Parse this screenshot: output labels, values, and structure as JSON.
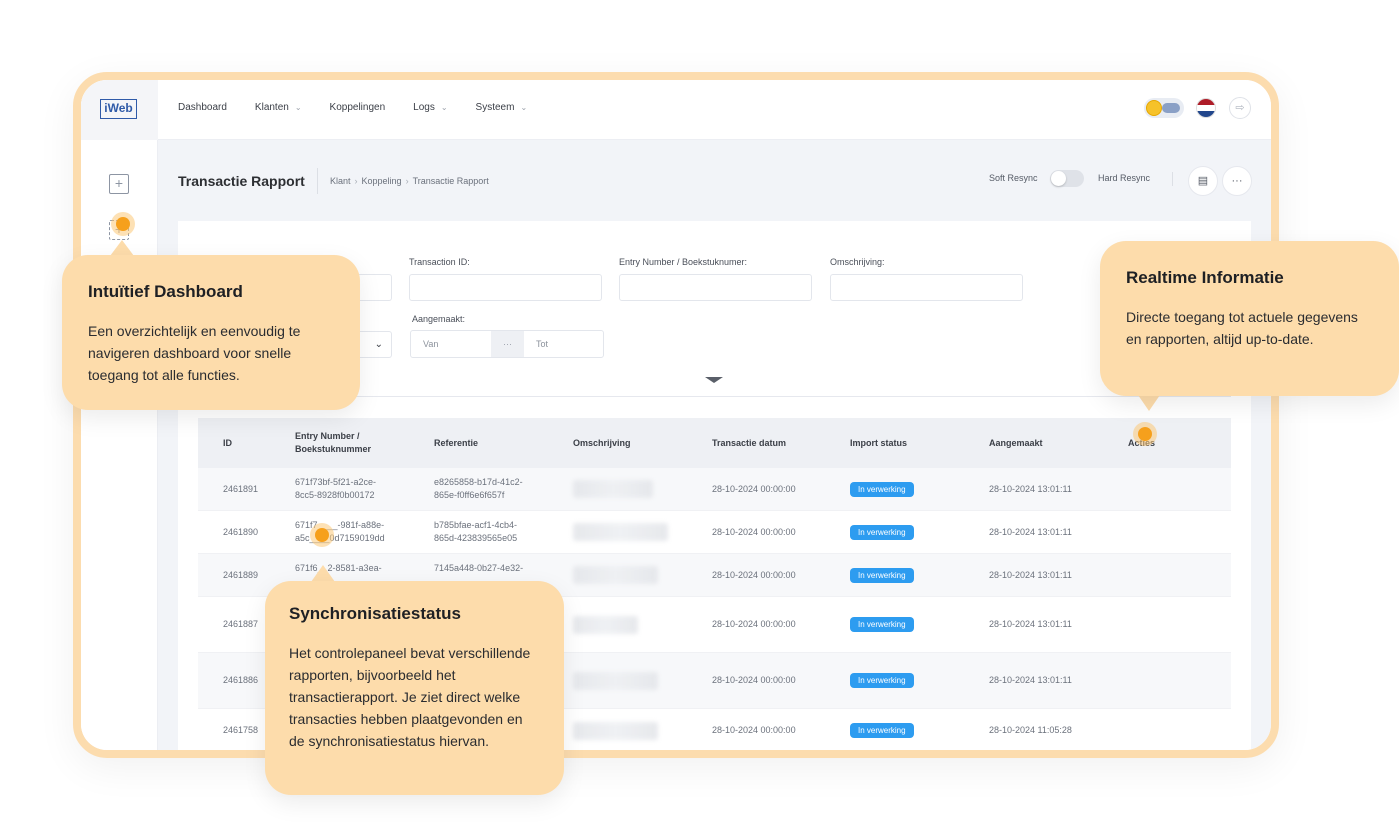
{
  "app": {
    "logo_text": "iWeb",
    "nav": [
      {
        "label": "Dashboard",
        "dropdown": false
      },
      {
        "label": "Klanten",
        "dropdown": true
      },
      {
        "label": "Koppelingen",
        "dropdown": false
      },
      {
        "label": "Logs",
        "dropdown": true
      },
      {
        "label": "Systeem",
        "dropdown": true
      }
    ],
    "language_flag": "nl-flag-icon",
    "colors": {
      "accent": "#2d9cf0",
      "callout": "#fddcab",
      "frame": "#fcdcae",
      "marker": "#f6a01c"
    }
  },
  "page": {
    "title": "Transactie Rapport",
    "breadcrumb": [
      "Klant",
      "Koppeling",
      "Transactie Rapport"
    ],
    "soft_resync": "Soft Resync",
    "hard_resync": "Hard Resync",
    "more": "···"
  },
  "filters": {
    "transaction_id_label": "Transaction ID:",
    "entry_number_label": "Entry Number / Boekstuknumer:",
    "omschrijving_label": "Omschrijving:",
    "aangemaakt_label": "Aangemaakt:",
    "van_placeholder": "Van",
    "dots": "···",
    "tot_placeholder": "Tot"
  },
  "table": {
    "headers": {
      "id": "ID",
      "entry_line1": "Entry Number /",
      "entry_line2": "Boekstuknummer",
      "referentie": "Referentie",
      "omschrijving": "Omschrijving",
      "transactie_datum": "Transactie datum",
      "import_status": "Import status",
      "aangemaakt": "Aangemaakt",
      "acties": "Acties"
    },
    "rows": [
      {
        "id": "2461891",
        "entry1": "671f73bf-5f21-a2ce-",
        "entry2": "8cc5-8928f0b00172",
        "ref1": "e8265858-b17d-41c2-",
        "ref2": "865e-f0ff6e6f657f",
        "datum": "28-10-2024 00:00:00",
        "status": "In verwerking",
        "aangemaakt": "28-10-2024 13:01:11"
      },
      {
        "id": "2461890",
        "entry1": "671f7____-981f-a88e-",
        "entry2": "a5c____0d7159019dd",
        "ref1": "b785bfae-acf1-4cb4-",
        "ref2": "865d-423839565e05",
        "datum": "28-10-2024 00:00:00",
        "status": "In verwerking",
        "aangemaakt": "28-10-2024 13:01:11"
      },
      {
        "id": "2461889",
        "entry1": "671f6__2-8581-a3ea-",
        "entry2": "",
        "ref1": "7145a448-0b27-4e32-",
        "ref2": "",
        "datum": "28-10-2024 00:00:00",
        "status": "In verwerking",
        "aangemaakt": "28-10-2024 13:01:11"
      },
      {
        "id": "2461887",
        "entry1": "",
        "entry2": "",
        "ref1": "",
        "ref2": "",
        "datum": "28-10-2024 00:00:00",
        "status": "In verwerking",
        "aangemaakt": "28-10-2024 13:01:11"
      },
      {
        "id": "2461886",
        "entry1": "",
        "entry2": "",
        "ref1": "",
        "ref2": "",
        "datum": "28-10-2024 00:00:00",
        "status": "In verwerking",
        "aangemaakt": "28-10-2024 13:01:11"
      },
      {
        "id": "2461758",
        "entry1": "",
        "entry2": "",
        "ref1": "",
        "ref2": "",
        "datum": "28-10-2024 00:00:00",
        "status": "In verwerking",
        "aangemaakt": "28-10-2024 11:05:28"
      }
    ]
  },
  "callouts": {
    "dashboard": {
      "title": "Intuïtief Dashboard",
      "text": "Een overzichtelijk en eenvoudig te navigeren dashboard voor snelle toegang tot alle functies."
    },
    "realtime": {
      "title": "Realtime Informatie",
      "text": "Directe toegang tot actuele gegevens en rapporten, altijd up-to-date."
    },
    "sync": {
      "title": "Synchronisatiestatus",
      "text": "Het controlepaneel bevat verschillende rapporten, bijvoorbeeld het transactierapport. Je ziet direct welke transacties hebben plaatgevonden en de synchronisatiestatus hiervan."
    }
  }
}
